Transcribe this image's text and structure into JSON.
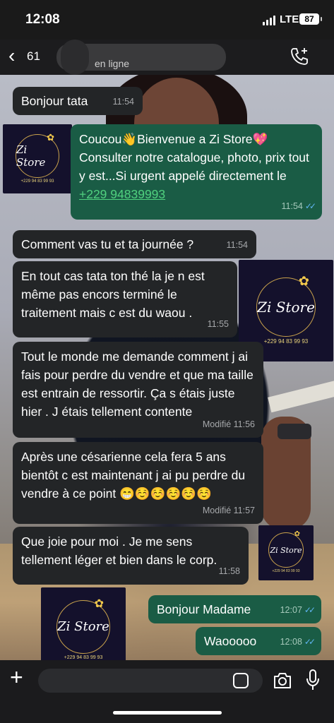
{
  "status_bar": {
    "time": "12:08",
    "network": "LTE",
    "battery": "87"
  },
  "header": {
    "unread_count": "61",
    "status": "en ligne",
    "call_icon": "phone-plus-icon"
  },
  "messages": [
    {
      "dir": "in",
      "text": "Bonjour tata",
      "time": "11:54"
    },
    {
      "dir": "out",
      "text_before": "Coucou👋Bienvenue a Zi Store💖 Consulter notre catalogue, photo, prix tout y est...Si urgent appelé directement le ",
      "link": "+229 94839993",
      "time": "11:54"
    },
    {
      "dir": "in",
      "text": "Comment vas tu et ta journée ?",
      "time": "11:54"
    },
    {
      "dir": "in",
      "text": "En tout cas tata ton thé la je n est même pas encors terminé le traitement mais c est du waou .",
      "time": "11:55"
    },
    {
      "dir": "in",
      "text": "Tout le monde me demande comment j ai fais pour perdre du vendre et que ma taille est entrain de ressortir.  Ça s étais juste hier . J étais tellement contente",
      "time": "Modifié 11:56"
    },
    {
      "dir": "in",
      "text": "Après  une césarienne  cela fera 5 ans bientôt c est maintenant j ai pu perdre du vendre à ce point 😁☺️☺️☺️☺️☺️",
      "time": "Modifié 11:57"
    },
    {
      "dir": "in",
      "text": "Que joie pour moi . Je me sens tellement léger et bien dans le corp.",
      "time": "11:58"
    },
    {
      "dir": "out",
      "text": "Bonjour Madame",
      "time": "12:07"
    },
    {
      "dir": "out",
      "text": "Waooooo",
      "time": "12:08"
    }
  ],
  "logo": {
    "name": "Zi Store",
    "phone": "+229 94 83 99 93"
  },
  "colors": {
    "incoming_bubble": "#232527",
    "outgoing_bubble": "#1a5c45",
    "link": "#50d17f",
    "read_ticks": "#5fb5f2"
  },
  "icons": {
    "back": "chevron-left-icon",
    "plus": "plus-icon",
    "sticker": "sticker-icon",
    "camera": "camera-icon",
    "mic": "microphone-icon"
  }
}
